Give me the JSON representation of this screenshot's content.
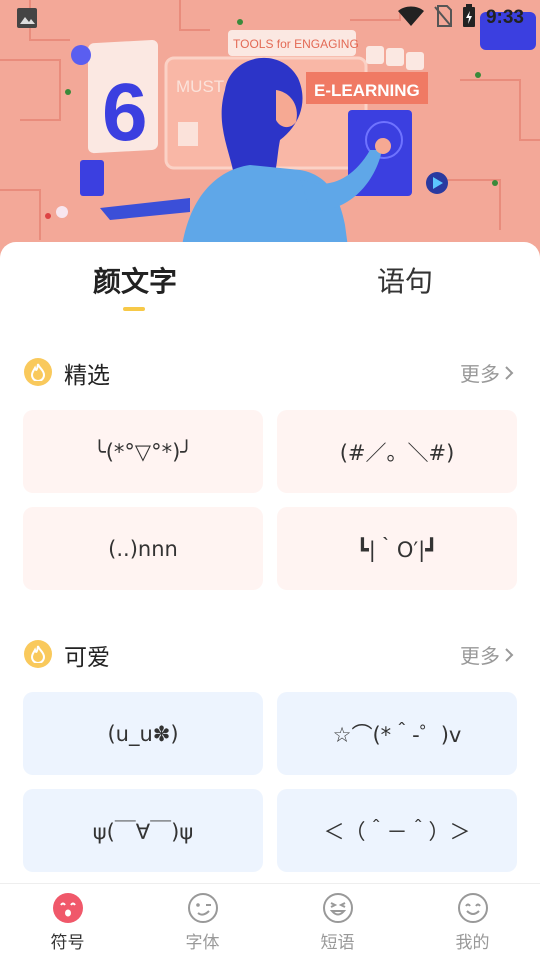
{
  "status_bar": {
    "time": "9:33"
  },
  "banner": {
    "number": "6",
    "must_have": "MUST HAVE",
    "tools_line": "TOOLS for ENGAGING",
    "elearning": "E-LEARNING"
  },
  "tabs": [
    {
      "label": "颜文字",
      "active": true
    },
    {
      "label": "语句",
      "active": false
    }
  ],
  "sections": [
    {
      "title": "精选",
      "more_label": "更多",
      "items": [
        "╰(*°▽°*)╯",
        "(#／。＼#)",
        "(..)nnn",
        "┗|｀O′|┛"
      ]
    },
    {
      "title": "可爱",
      "more_label": "更多",
      "items": [
        "(u_u✽)",
        "☆⌒(*＾-゜)v",
        "ψ(￣∀￣)ψ",
        "＜（＾－＾）＞"
      ]
    }
  ],
  "bottom_nav": [
    {
      "label": "符号",
      "icon": "symbol-face-icon",
      "active": true
    },
    {
      "label": "字体",
      "icon": "wink-face-icon",
      "active": false
    },
    {
      "label": "短语",
      "icon": "laugh-face-icon",
      "active": false
    },
    {
      "label": "我的",
      "icon": "smile-face-icon",
      "active": false
    }
  ],
  "colors": {
    "banner_bg": "#f3a898",
    "accent_yellow": "#f7c948",
    "card_pink": "#fff4f2",
    "card_blue": "#edf4fe",
    "active_nav": "#f0586a"
  }
}
